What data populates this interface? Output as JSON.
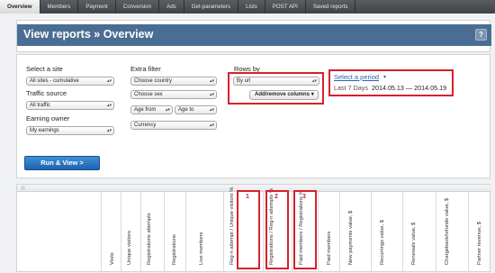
{
  "nav": {
    "tabs": [
      "Overview",
      "Members",
      "Payment",
      "Conversion",
      "Ads",
      "Get-parameters",
      "Lists",
      "POST API",
      "Saved reports"
    ]
  },
  "header": {
    "title": "View reports » Overview",
    "help": "?"
  },
  "filters": {
    "site_label": "Select a site",
    "site_value": "All sites - cumulative",
    "traffic_label": "Traffic source",
    "traffic_value": "All traffic",
    "earning_label": "Earning owner",
    "earning_value": "My earnings",
    "extra_label": "Extra filter",
    "country": "Choose country",
    "sex": "Choose sex",
    "age_from": "Age from",
    "age_to": "Age to",
    "currency": "Currency",
    "rows_label": "Rows by",
    "rows_value": "By url",
    "add_remove": "Add/remove columns",
    "period_link": "Select a period",
    "period_preset": "Last 7 Days",
    "period_range": "2014.05.13 — 2014.05.19",
    "run": "Run & View >"
  },
  "table": {
    "columns": [
      "Visits",
      "Unique visitors",
      "Registrations attempts",
      "Registrations",
      "Live members",
      "Reg-n attempt / Unique visitors %",
      "Registrations / Reg-n attempts %",
      "Paid members / Registrations %",
      "Paid members",
      "New payments value, $",
      "Recurrings value, $",
      "Renewals value, $",
      "Chargeback/refunds value, $",
      "Partner revenue, $"
    ],
    "markers": [
      "1",
      "2",
      "3"
    ]
  }
}
